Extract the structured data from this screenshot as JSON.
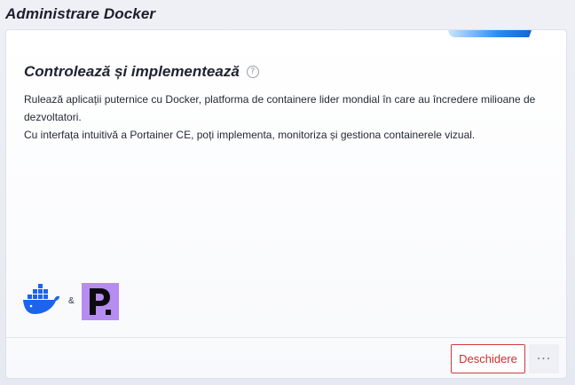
{
  "window": {
    "title": "Administrare Docker"
  },
  "card": {
    "heading": "Controlează și implementează",
    "help_icon": "question-circle-icon",
    "description_line1": "Rulează aplicații puternice cu Docker, platforma de containere lider mondial în care au încredere milioane de dezvoltatori.",
    "description_line2": "Cu interfața intuitivă a Portainer CE, poți implementa, monitoriza și gestiona containerele vizual.",
    "logos": {
      "docker": "docker-whale-icon",
      "separator": "&",
      "portainer": "portainer-logo"
    },
    "accent_color": "#2d8bf0",
    "docker_color": "#1d63ed",
    "portainer_color": "#b68cf0"
  },
  "footer": {
    "open_label": "Deschidere",
    "more_label": "···",
    "open_color": "#c92f2f"
  }
}
